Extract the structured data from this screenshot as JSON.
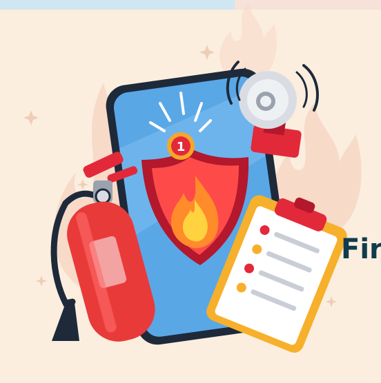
{
  "illustration": {
    "badge_number": "1",
    "caption_text": "Fir",
    "colors": {
      "background": "#fbeede",
      "flame_bg": "#f6d6c4",
      "phone_frame": "#1e2a3a",
      "phone_screen": "#5aa7e6",
      "shield_outer": "#d8283a",
      "shield_inner": "#ff4a4a",
      "flame_orange": "#ff8b2b",
      "flame_yellow": "#ffd23f",
      "extinguisher_red": "#e93a3a",
      "clipboard_orange": "#f7b02b",
      "alarm_gray": "#d9dde3",
      "caption": "#0f3b4d"
    },
    "icons": [
      "smartphone-icon",
      "fire-shield-icon",
      "fire-extinguisher-icon",
      "fire-alarm-bell-icon",
      "checklist-clipboard-icon"
    ]
  }
}
